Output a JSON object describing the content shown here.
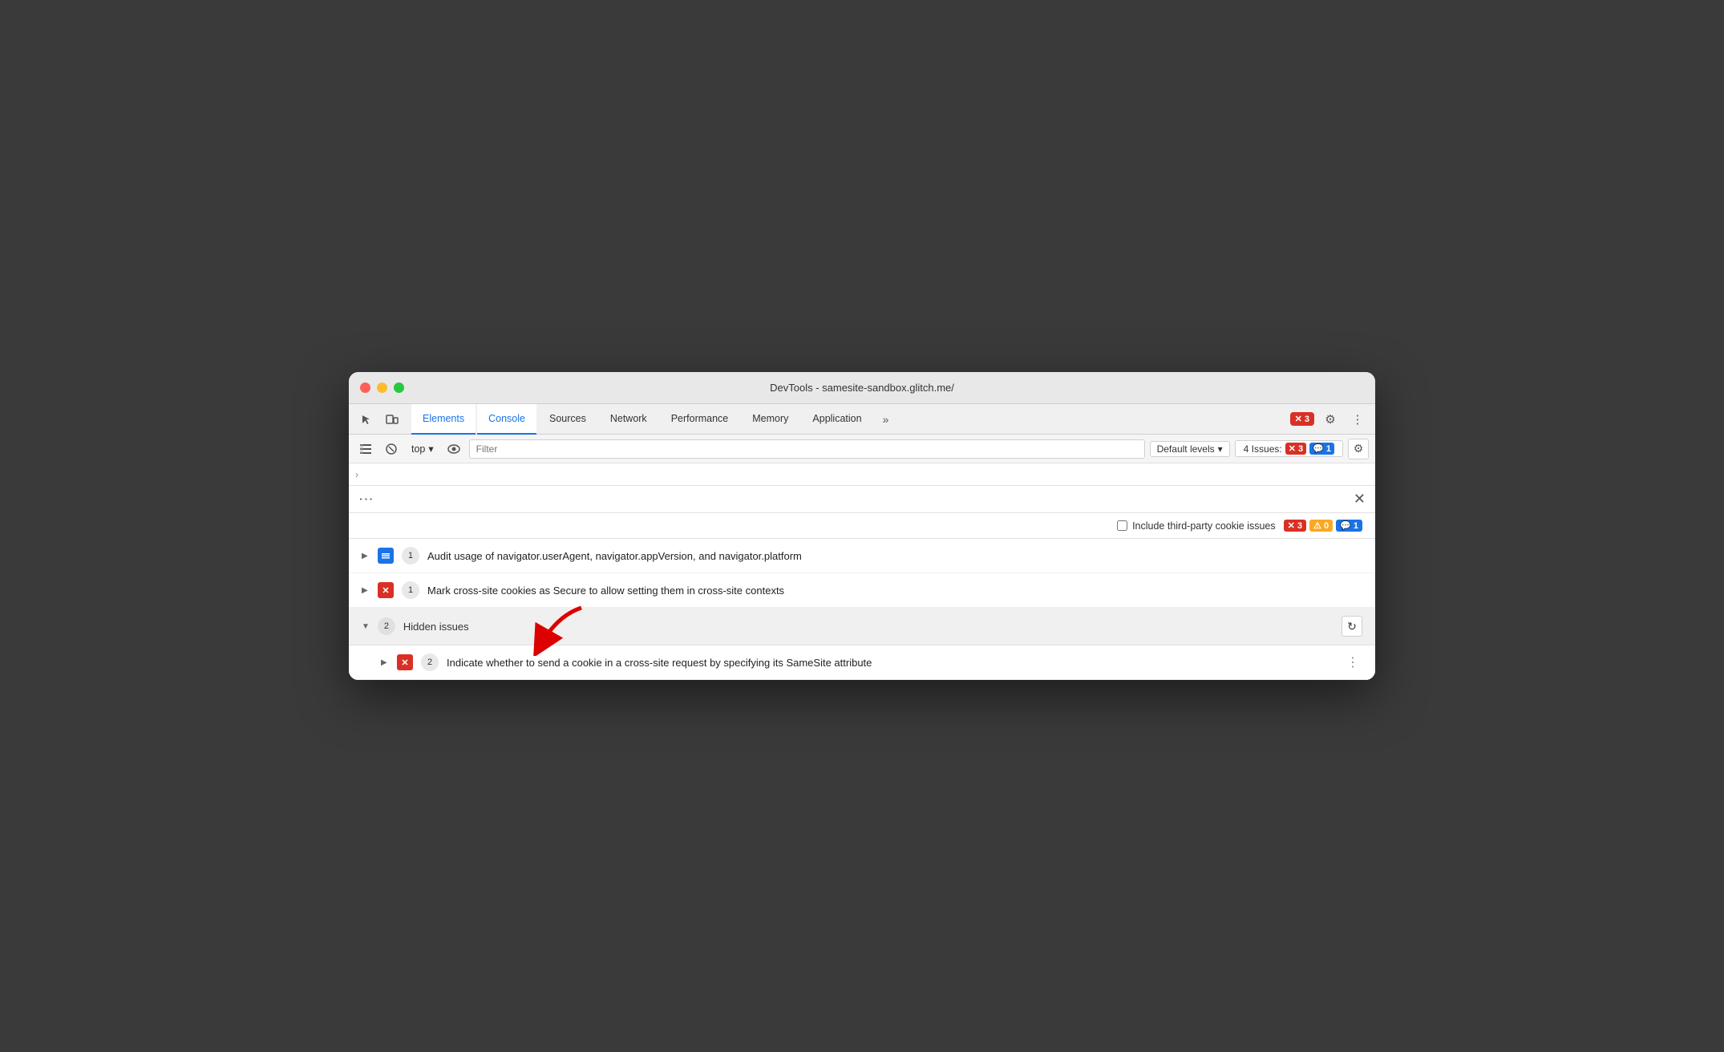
{
  "window": {
    "title": "DevTools - samesite-sandbox.glitch.me/"
  },
  "tabbar": {
    "tabs": [
      {
        "label": "Elements",
        "active": false
      },
      {
        "label": "Console",
        "active": true
      },
      {
        "label": "Sources",
        "active": false
      },
      {
        "label": "Network",
        "active": false
      },
      {
        "label": "Performance",
        "active": false
      },
      {
        "label": "Memory",
        "active": false
      },
      {
        "label": "Application",
        "active": false
      }
    ],
    "more_tabs_label": "»",
    "error_count": "3",
    "gear_icon": "⚙",
    "dots_icon": "⋮"
  },
  "toolbar": {
    "top_label": "top",
    "filter_placeholder": "Filter",
    "default_levels_label": "Default levels",
    "issues_label": "4 Issues:",
    "issues_error_count": "3",
    "issues_info_count": "1"
  },
  "issues_panel": {
    "include_third_party_label": "Include third-party cookie issues",
    "badge_error": "3",
    "badge_warning": "0",
    "badge_info": "1",
    "issues": [
      {
        "id": "issue-1",
        "icon_type": "blue",
        "icon_label": "■",
        "count": "1",
        "text": "Audit usage of navigator.userAgent, navigator.appVersion, and navigator.platform"
      },
      {
        "id": "issue-2",
        "icon_type": "red",
        "icon_label": "✕",
        "count": "1",
        "text": "Mark cross-site cookies as Secure to allow setting them in cross-site contexts"
      }
    ],
    "hidden_issues": {
      "count": "2",
      "label": "Hidden issues",
      "sub_issues": [
        {
          "id": "sub-issue-1",
          "icon_type": "red",
          "icon_label": "✕",
          "count": "2",
          "text": "Indicate whether to send a cookie in a cross-site request by specifying its SameSite attribute"
        }
      ]
    }
  },
  "arrow": {
    "description": "Red arrow pointing to Hidden issues row"
  }
}
